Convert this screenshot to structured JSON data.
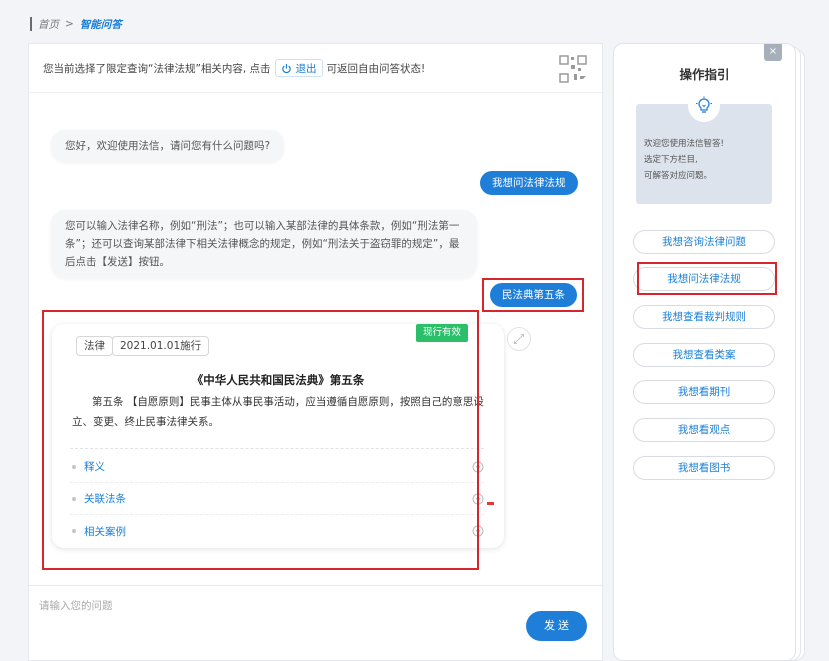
{
  "breadcrumb": {
    "home": "首页",
    "separator": ">",
    "current": "智能问答"
  },
  "notice": {
    "text_before": "您当前选择了限定查询“法律法规”相关内容, 点击",
    "exit_label": "退出",
    "text_after": "可返回自由问答状态!"
  },
  "chat": {
    "greeting": "您好，欢迎使用法信，请问您有什么问题吗?",
    "user_msg_1": "我想问法律法规",
    "bot_instruction": "您可以输入法律名称，例如“刑法”；也可以输入某部法律的具体条款，例如“刑法第一条”；还可以查询某部法律下相关法律概念的规定，例如“刑法关于盗窃罪的规定”，最后点击【发送】按钮。",
    "user_msg_2": "民法典第五条"
  },
  "law_card": {
    "tag_type": "法律",
    "tag_date": "2021.01.01施行",
    "status": "现行有效",
    "title": "《中华人民共和国民法典》第五条",
    "body": "第五条 【自愿原则】民事主体从事民事活动，应当遵循自愿原则，按照自己的意思设立、变更、终止民事法律关系。",
    "sections": [
      "释义",
      "关联法条",
      "相关案例"
    ]
  },
  "input": {
    "placeholder": "请输入您的问题",
    "send_label": "发送"
  },
  "guide": {
    "title": "操作指引",
    "close": "×",
    "tip_lines": [
      "欢迎您使用法信智答!",
      "选定下方栏目,",
      "可解答对应问题。"
    ],
    "buttons": [
      "我想咨询法律问题",
      "我想问法律法规",
      "我想查看裁判规则",
      "我想查看类案",
      "我想看期刊",
      "我想看观点",
      "我想看图书"
    ]
  },
  "colors": {
    "accent": "#1f7fd8",
    "highlight": "#d7252d",
    "status_green": "#2cbf6a"
  },
  "icons": [
    "power-icon",
    "qr-code-icon",
    "expand-icon",
    "chevron-down-icon",
    "lightbulb-icon"
  ]
}
